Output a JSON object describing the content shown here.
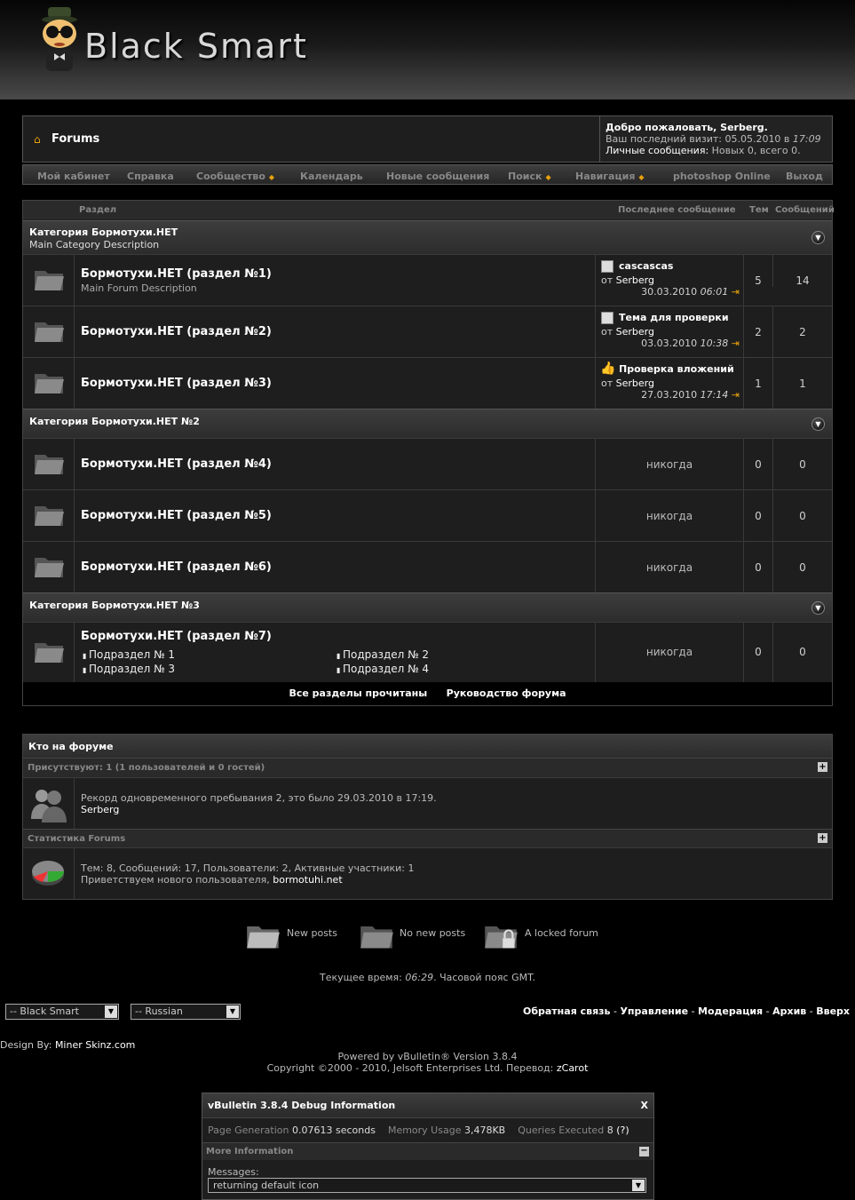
{
  "header": {
    "logo_text": "Black Smart"
  },
  "navbar": {
    "crumb": "Forums",
    "welcome_prefix": "Добро пожаловать, ",
    "username": "Serberg",
    "welcome_suffix": ".",
    "last_visit_label": "Ваш последний визит: ",
    "last_visit_date": "05.05.2010 в ",
    "last_visit_time": "17:09",
    "pm_label": "Личные сообщения: ",
    "pm_value": "Новых 0, всего 0."
  },
  "menu": {
    "items": [
      "Мой кабинет",
      "Справка",
      "Сообщество",
      "Календарь",
      "Новые сообщения",
      "Поиск",
      "Навигация",
      "photoshop Online",
      "Выход"
    ]
  },
  "forum_table": {
    "headers": {
      "section": "Раздел",
      "last_post": "Последнее сообщение",
      "threads": "Тем",
      "posts": "Сообщений"
    },
    "cat1": {
      "title": "Категория Бормотухи.НЕТ",
      "desc": "Main Category Description"
    },
    "cat2": {
      "title": "Категория Бормотухи.НЕТ №2"
    },
    "cat3": {
      "title": "Категория Бормотухи.НЕТ №3"
    },
    "forums": [
      {
        "title": "Бормотухи.НЕТ (раздел №1)",
        "desc": "Main Forum Description",
        "last_title": "cascascas",
        "by": "от ",
        "author": "Serberg",
        "date": "30.03.2010 ",
        "time": "06:01",
        "threads": "5",
        "posts": "14"
      },
      {
        "title": "Бормотухи.НЕТ (раздел №2)",
        "last_title": "Тема для проверки",
        "by": "от ",
        "author": "Serberg",
        "date": "03.03.2010 ",
        "time": "10:38",
        "threads": "2",
        "posts": "2"
      },
      {
        "title": "Бормотухи.НЕТ (раздел №3)",
        "last_title": "Проверка вложений",
        "by": "от ",
        "author": "Serberg",
        "date": "27.03.2010 ",
        "time": "17:14",
        "threads": "1",
        "posts": "1"
      },
      {
        "title": "Бормотухи.НЕТ (раздел №4)",
        "last": "никогда",
        "threads": "0",
        "posts": "0"
      },
      {
        "title": "Бормотухи.НЕТ (раздел №5)",
        "last": "никогда",
        "threads": "0",
        "posts": "0"
      },
      {
        "title": "Бормотухи.НЕТ (раздел №6)",
        "last": "никогда",
        "threads": "0",
        "posts": "0"
      },
      {
        "title": "Бормотухи.НЕТ (раздел №7)",
        "last": "никогда",
        "threads": "0",
        "posts": "0",
        "subforums": [
          "Подраздел № 1",
          "Подраздел № 2",
          "Подраздел № 3",
          "Подраздел № 4"
        ]
      }
    ],
    "footer_links": [
      "Все разделы прочитаны",
      "Руководство форума"
    ]
  },
  "whos_online": {
    "title": "Кто на форуме",
    "present_label": "Присутствуют: 1 (1 пользователей и 0 гостей)",
    "record_text": "Рекорд одновременного пребывания 2, это было 29.03.2010 в 17:19.",
    "online_user": "Serberg",
    "stats_label": "Статистика Forums",
    "stats_text": "Тем: 8, Сообщений: 17, Пользователи: 2, Активные участники: 1",
    "welcome_new": "Приветствуем нового пользователя, ",
    "new_user": "bormotuhi.net"
  },
  "legend": {
    "new_posts": "New posts",
    "no_new_posts": "No new posts",
    "locked": "A locked forum"
  },
  "time_line": {
    "prefix": "Текущее время: ",
    "time": "06:29",
    "suffix": ". Часовой пояс GMT."
  },
  "footer": {
    "style_select": "-- Black Smart",
    "lang_select": "-- Russian",
    "links": [
      "Обратная связь",
      "Управление",
      "Модерация",
      "Архив",
      "Вверх"
    ],
    "design_label": "Design By: ",
    "design_name": "Miner Skinz.com",
    "powered": "Powered by vBulletin® Version 3.8.4",
    "copyright": "Copyright ©2000 - 2010, Jelsoft Enterprises Ltd. Перевод: ",
    "translator": "zCarot"
  },
  "debug": {
    "title": "vBulletin 3.8.4 Debug Information",
    "close": "X",
    "page_gen_label": "Page Generation ",
    "page_gen_value": "0.07613 seconds",
    "memory_label": "Memory Usage ",
    "memory_value": "3,478KB",
    "queries_label": "Queries Executed ",
    "queries_value": "8",
    "queries_link": "(?)",
    "more_info": "More Information",
    "messages_label": "Messages:",
    "messages_value": "returning default icon"
  },
  "colors": {
    "accent": "#e7a10c",
    "background": "#000000",
    "panel": "#1e1e1e"
  }
}
